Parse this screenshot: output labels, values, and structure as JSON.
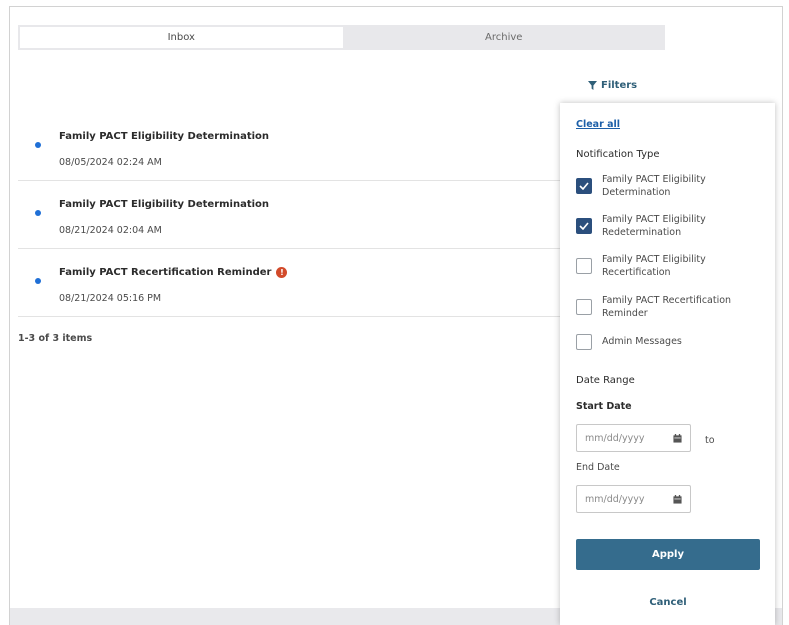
{
  "tabs": [
    {
      "label": "Inbox",
      "active": true
    },
    {
      "label": "Archive",
      "active": false
    }
  ],
  "filters_toggle": {
    "label": "Filters",
    "icon": "funnel-icon"
  },
  "notifications": [
    {
      "title": "Family PACT Eligibility Determination",
      "date": "08/05/2024 02:24 AM",
      "unread": true,
      "alert": false
    },
    {
      "title": "Family PACT Eligibility Determination",
      "date": "08/21/2024 02:04 AM",
      "unread": true,
      "alert": false
    },
    {
      "title": "Family PACT Recertification Reminder",
      "date": "08/21/2024 05:16 PM",
      "unread": true,
      "alert": true
    }
  ],
  "item_count": "1-3 of 3 items",
  "filter_panel": {
    "clear_all": "Clear all",
    "notification_type_label": "Notification Type",
    "options": [
      {
        "label": "Family PACT Eligibility Determination",
        "checked": true
      },
      {
        "label": "Family PACT Eligibility Redetermination",
        "checked": true
      },
      {
        "label": "Family PACT Eligibility Recertification",
        "checked": false
      },
      {
        "label": "Family PACT Recertification Reminder",
        "checked": false
      },
      {
        "label": "Admin Messages",
        "checked": false
      }
    ],
    "date_range_label": "Date Range",
    "start_date_label": "Start Date",
    "start_date_placeholder": "mm/dd/yyyy",
    "to_label": "to",
    "end_date_label": "End Date",
    "end_date_placeholder": "mm/dd/yyyy",
    "apply_label": "Apply",
    "cancel_label": "Cancel"
  },
  "colors": {
    "accent": "#356c8d",
    "checkbox_checked": "#2b4f7d",
    "unread_dot": "#1f6fd6",
    "alert": "#d24a2a",
    "link": "#1c5fa8"
  }
}
